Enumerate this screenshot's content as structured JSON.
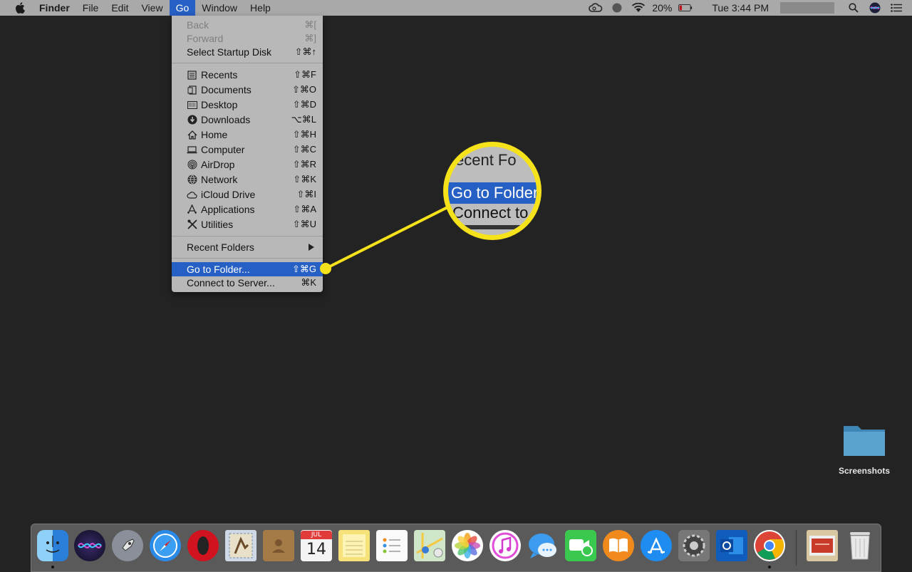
{
  "menubar": {
    "app_name": "Finder",
    "menus": [
      "File",
      "Edit",
      "View",
      "Go",
      "Window",
      "Help"
    ],
    "active_menu": "Go",
    "battery": "20%",
    "clock": "Tue 3:44 PM",
    "icons": [
      "apple-icon",
      "creative-cloud-icon",
      "status-icon",
      "wifi-icon",
      "battery-icon",
      "search-icon",
      "siri-icon",
      "list-icon"
    ]
  },
  "go_menu": {
    "items": [
      {
        "label": "Back",
        "shortcut": "⌘[",
        "disabled": true
      },
      {
        "label": "Forward",
        "shortcut": "⌘]",
        "disabled": true
      },
      {
        "label": "Select Startup Disk",
        "shortcut": "⇧⌘↑",
        "disabled": false
      },
      {
        "label": "Recents",
        "shortcut": "⇧⌘F",
        "icon": "recents-icon"
      },
      {
        "label": "Documents",
        "shortcut": "⇧⌘O",
        "icon": "documents-icon"
      },
      {
        "label": "Desktop",
        "shortcut": "⇧⌘D",
        "icon": "desktop-icon"
      },
      {
        "label": "Downloads",
        "shortcut": "⌥⌘L",
        "icon": "downloads-icon"
      },
      {
        "label": "Home",
        "shortcut": "⇧⌘H",
        "icon": "home-icon"
      },
      {
        "label": "Computer",
        "shortcut": "⇧⌘C",
        "icon": "computer-icon"
      },
      {
        "label": "AirDrop",
        "shortcut": "⇧⌘R",
        "icon": "airdrop-icon"
      },
      {
        "label": "Network",
        "shortcut": "⇧⌘K",
        "icon": "network-icon"
      },
      {
        "label": "iCloud Drive",
        "shortcut": "⇧⌘I",
        "icon": "icloud-icon"
      },
      {
        "label": "Applications",
        "shortcut": "⇧⌘A",
        "icon": "applications-icon"
      },
      {
        "label": "Utilities",
        "shortcut": "⇧⌘U",
        "icon": "utilities-icon"
      },
      {
        "label": "Recent Folders",
        "submenu": true
      },
      {
        "label": "Go to Folder...",
        "shortcut": "⇧⌘G",
        "highlighted": true
      },
      {
        "label": "Connect to Server...",
        "shortcut": "⌘K"
      }
    ]
  },
  "magnifier": {
    "line1": "ecent Fo",
    "line2": "Go to Folder",
    "line3": "Connect to"
  },
  "desktop": {
    "folder_label": "Screenshots"
  },
  "dock": {
    "date_month": "JUL",
    "date_day": "14",
    "apps": [
      "finder-icon",
      "siri-icon",
      "launchpad-icon",
      "safari-icon",
      "opera-icon",
      "mail-icon",
      "contacts-icon",
      "calendar-icon",
      "notes-icon",
      "reminders-icon",
      "maps-icon",
      "photos-icon",
      "itunes-icon",
      "messages-icon",
      "facetime-icon",
      "ibooks-icon",
      "app-store-icon",
      "system-preferences-icon",
      "outlook-icon",
      "chrome-icon",
      "downloads-stack-icon",
      "trash-icon"
    ]
  },
  "colors": {
    "highlight": "#2760c4",
    "callout": "#f6e21a",
    "desktop": "#232323"
  }
}
